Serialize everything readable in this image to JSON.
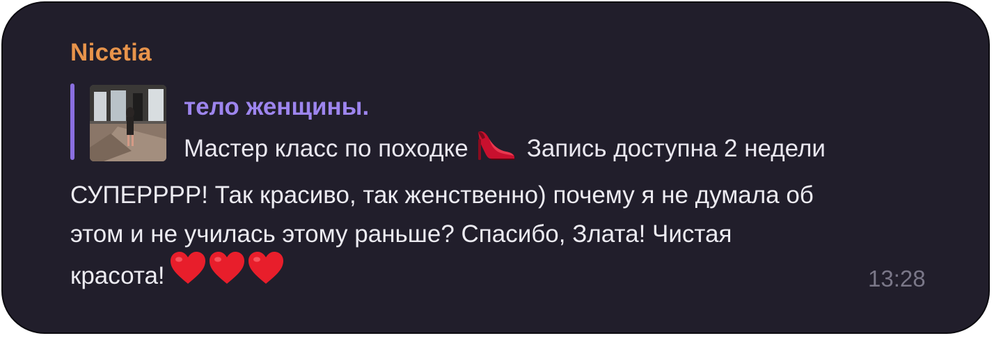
{
  "message": {
    "sender": "Nicetia",
    "reply": {
      "title": "тело женщины.",
      "text_before_emoji": "Мастер класс по походке",
      "emoji": "high-heel-shoe",
      "text_after_emoji": "Запись доступна 2 недели"
    },
    "body_lines": [
      "СУПЕРРРР! Так красиво, так женственно) почему я не думала об",
      "этом и не училась этому раньше? Спасибо, Злата! Чистая",
      "красота!"
    ],
    "trailing_emoji": [
      "red-heart",
      "red-heart",
      "red-heart"
    ],
    "time": "13:28"
  },
  "colors": {
    "bubble_bg": "#211e2b",
    "sender": "#e8944b",
    "reply_accent": "#8a6fe0",
    "reply_title": "#9d85ee",
    "text": "#ecebf1",
    "time": "#7a7788",
    "heart": "#e81e2b"
  }
}
